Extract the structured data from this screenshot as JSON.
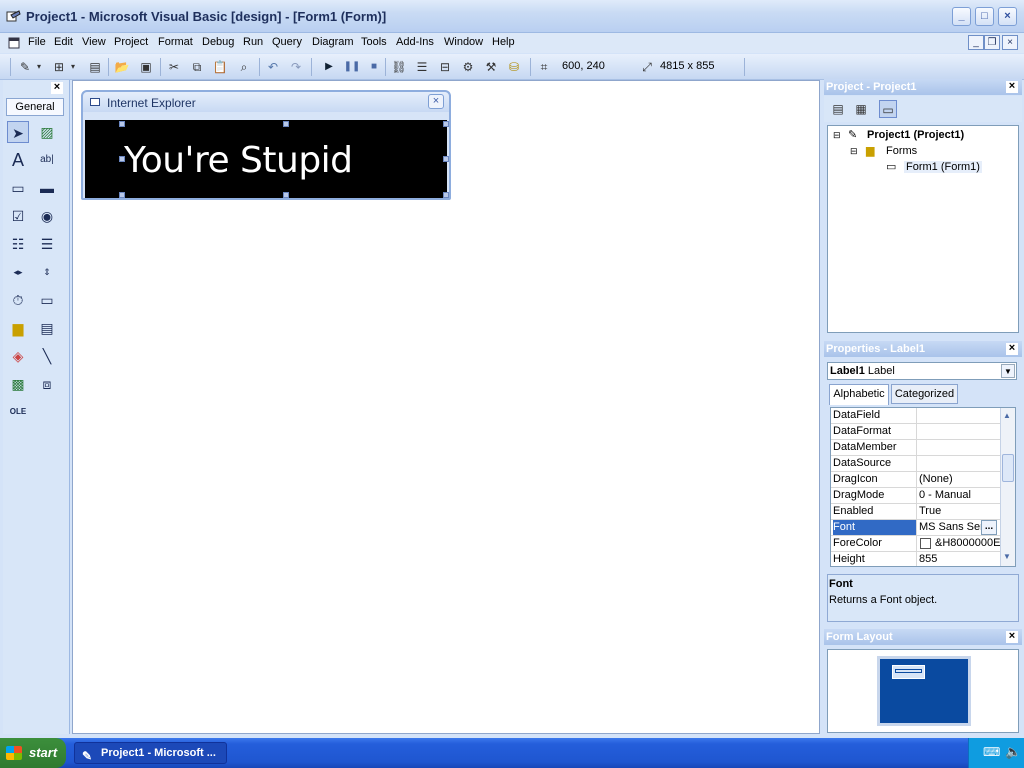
{
  "window": {
    "title": "Project1 - Microsoft Visual Basic [design] - [Form1 (Form)]",
    "minimize": "_",
    "maximize": "□",
    "close": "×"
  },
  "menu": {
    "items": [
      "File",
      "Edit",
      "View",
      "Project",
      "Format",
      "Debug",
      "Run",
      "Query",
      "Diagram",
      "Tools",
      "Add-Ins",
      "Window",
      "Help"
    ],
    "mdi_min": "_",
    "mdi_restore": "❐",
    "mdi_close": "×"
  },
  "toolbar": {
    "position": "600, 240",
    "size": "4815 x 855"
  },
  "toolbox": {
    "tab_label": "General",
    "close": "×"
  },
  "form": {
    "title": "Internet Explorer",
    "close": "×",
    "label_caption": "You're Stupid"
  },
  "project_panel": {
    "title": "Project - Project1",
    "close": "×",
    "root": "Project1 (Project1)",
    "folder": "Forms",
    "form_item": "Form1 (Form1)"
  },
  "properties_panel": {
    "title": "Properties - Label1",
    "close": "×",
    "object_name": "Label1",
    "object_type": "Label",
    "tabs": [
      "Alphabetic",
      "Categorized"
    ],
    "rows": [
      {
        "name": "DataField",
        "value": ""
      },
      {
        "name": "DataFormat",
        "value": ""
      },
      {
        "name": "DataMember",
        "value": ""
      },
      {
        "name": "DataSource",
        "value": ""
      },
      {
        "name": "DragIcon",
        "value": "(None)"
      },
      {
        "name": "DragMode",
        "value": "0 - Manual"
      },
      {
        "name": "Enabled",
        "value": "True"
      },
      {
        "name": "Font",
        "value": "MS Sans Serif"
      },
      {
        "name": "ForeColor",
        "value": "&H8000000E"
      },
      {
        "name": "Height",
        "value": "855"
      }
    ],
    "desc_title": "Font",
    "desc_text": "Returns a Font object."
  },
  "form_layout": {
    "title": "Form Layout",
    "close": "×"
  },
  "taskbar": {
    "start_label": "start",
    "task_label": "Project1 - Microsoft ..."
  },
  "colors": {
    "accent": "#316ac5",
    "label_background": "#000000",
    "label_text": "#ffffff",
    "layout_monitor": "#0a4aa0"
  }
}
